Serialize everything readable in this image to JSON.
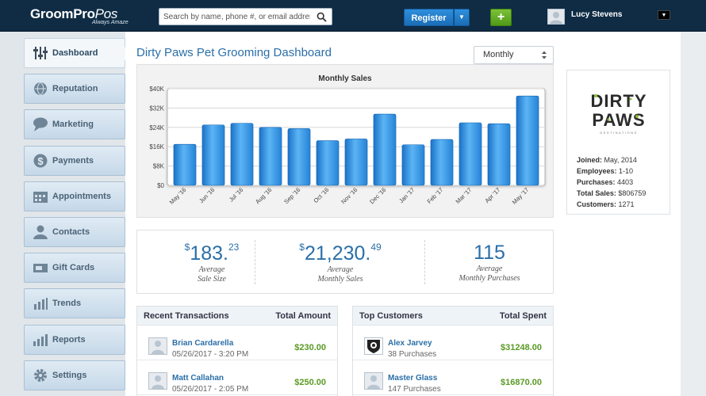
{
  "app": {
    "logo_main": "GroomPro",
    "logo_pos": "Pos",
    "tagline": "Always Amaze"
  },
  "search": {
    "placeholder": "Search by name, phone #, or email address",
    "value": ""
  },
  "header": {
    "register_label": "Register",
    "add_label": "+",
    "user_name": "Lucy Stevens"
  },
  "sidebar": {
    "items": [
      {
        "label": "Dashboard",
        "icon": "sliders-icon",
        "active": true
      },
      {
        "label": "Reputation",
        "icon": "globe-icon"
      },
      {
        "label": "Marketing",
        "icon": "speech-bubble-icon"
      },
      {
        "label": "Payments",
        "icon": "dollar-icon"
      },
      {
        "label": "Appointments",
        "icon": "calendar-icon"
      },
      {
        "label": "Contacts",
        "icon": "person-icon"
      },
      {
        "label": "Gift Cards",
        "icon": "gift-card-icon"
      },
      {
        "label": "Trends",
        "icon": "bar-trend-icon"
      },
      {
        "label": "Reports",
        "icon": "report-chart-icon"
      },
      {
        "label": "Settings",
        "icon": "gear-icon"
      }
    ]
  },
  "main": {
    "title": "Dirty Paws Pet Grooming Dashboard",
    "period": "Monthly"
  },
  "chart_data": {
    "type": "bar",
    "title": "Monthly Sales",
    "categories": [
      "May '16",
      "Jun '16",
      "Jul '16",
      "Aug '16",
      "Sep '16",
      "Oct '16",
      "Nov '16",
      "Dec '16",
      "Jan '17",
      "Feb '17",
      "Mar '17",
      "Apr '17",
      "May '17"
    ],
    "values": [
      17000,
      25000,
      25700,
      24000,
      23500,
      18500,
      19200,
      29500,
      16800,
      19000,
      25900,
      25500,
      37000
    ],
    "ylim": [
      0,
      40000
    ],
    "yticks": [
      0,
      8000,
      16000,
      24000,
      32000,
      40000
    ],
    "ytick_labels": [
      "$0",
      "$8K",
      "$16K",
      "$24K",
      "$32K",
      "$40K"
    ],
    "grid": true,
    "color": "#2e8fe0"
  },
  "stats": [
    {
      "currency": "$",
      "whole": "183.",
      "cents": "23",
      "label1": "Average",
      "label2": "Sale Size"
    },
    {
      "currency": "$",
      "whole": "21,230.",
      "cents": "49",
      "label1": "Average",
      "label2": "Monthly Sales"
    },
    {
      "currency": "",
      "whole": "115",
      "cents": "",
      "label1": "Average",
      "label2": "Monthly Purchases"
    }
  ],
  "transactions": {
    "title": "Recent Transactions",
    "amount_header": "Total Amount",
    "rows": [
      {
        "name": "Brian Cardarella",
        "sub": "05/26/2017 - 3:20 PM",
        "amount": "$230.00"
      },
      {
        "name": "Matt Callahan",
        "sub": "05/26/2017 - 2:05 PM",
        "amount": "$250.00"
      }
    ]
  },
  "customers": {
    "title": "Top Customers",
    "amount_header": "Total Spent",
    "rows": [
      {
        "name": "Alex Jarvey",
        "sub": "38 Purchases",
        "amount": "$31248.00"
      },
      {
        "name": "Master Glass",
        "sub": "147 Purchases",
        "amount": "$16870.00"
      }
    ]
  },
  "business": {
    "logo_line1": "DIRTY",
    "logo_line2": "PAWS",
    "logo_small": "DESTINATIONS",
    "joined_label": "Joined:",
    "joined": "May, 2014",
    "employees_label": "Employees:",
    "employees": "1-10",
    "purchases_label": "Purchases:",
    "purchases": "4403",
    "total_sales_label": "Total Sales:",
    "total_sales": "$806759",
    "customers_label": "Customers:",
    "customers": "1271"
  }
}
